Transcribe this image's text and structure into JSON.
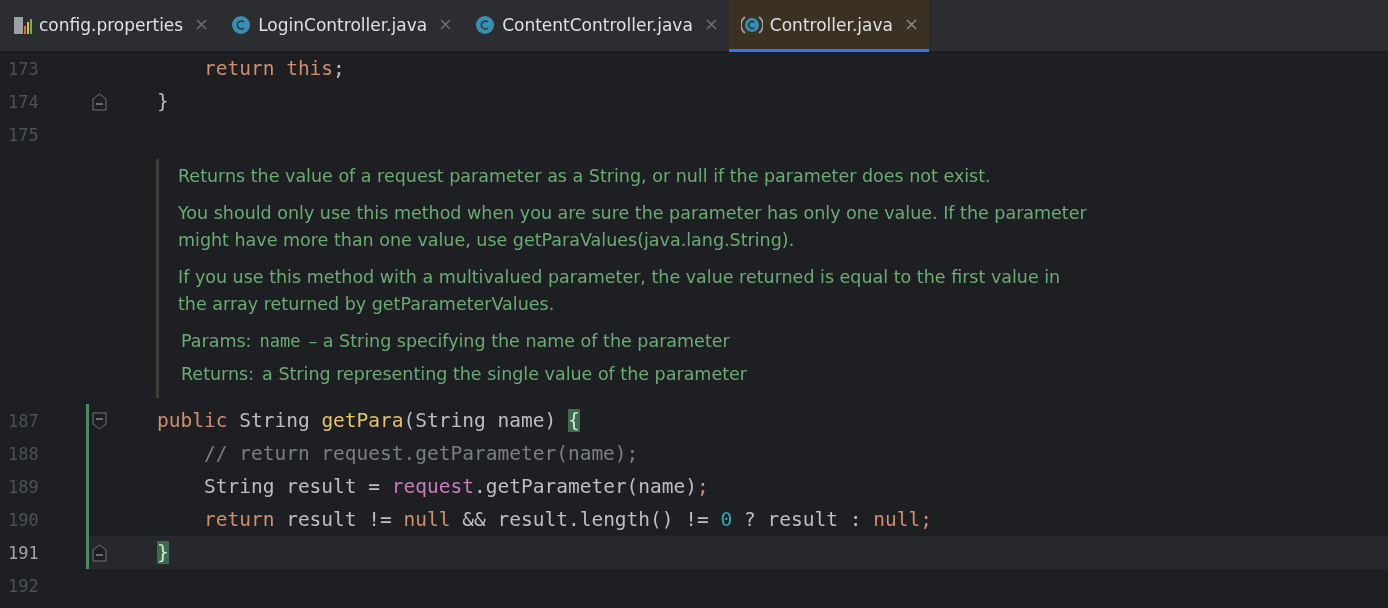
{
  "tabs": [
    {
      "label": "config.properties",
      "kind": "properties",
      "selected": false
    },
    {
      "label": "LoginController.java",
      "kind": "class",
      "selected": false
    },
    {
      "label": "ContentController.java",
      "kind": "class",
      "selected": false
    },
    {
      "label": "Controller.java",
      "kind": "abstract-class",
      "selected": true
    }
  ],
  "editor": {
    "lines_before": [
      {
        "number": "173",
        "current": false,
        "changed": false,
        "tokens": [
          {
            "kind": "keyword",
            "text": "    return this"
          },
          {
            "kind": "plain",
            "text": ";"
          }
        ]
      },
      {
        "number": "174",
        "current": false,
        "changed": false,
        "kind": "fold-end",
        "tokens": [
          {
            "kind": "plain",
            "text": "}"
          }
        ]
      },
      {
        "number": "175",
        "current": false,
        "changed": false
      }
    ],
    "doc": {
      "paragraphs": [
        "Returns the value of a request parameter as a String, or null if the parameter does not exist.",
        "You should only use this method when you are sure the parameter has only one value. If the parameter might have more than one value, use getParaValues(java.lang.String).",
        "If you use this method with a multivalued parameter, the value returned is equal to the first value in the array returned by getParameterValues."
      ],
      "tags": [
        {
          "label": "Params:",
          "code": "name",
          "text": "– a String specifying the name of the parameter"
        },
        {
          "label": "Returns:",
          "text": "a String representing the single value of the parameter"
        }
      ]
    },
    "lines_after": [
      {
        "number": "187",
        "current": false,
        "changed": true,
        "kind": "fold-start",
        "tokens": [
          {
            "kind": "keyword",
            "text": "public "
          },
          {
            "kind": "plain",
            "text": "String "
          },
          {
            "kind": "method",
            "text": "getPara"
          },
          {
            "kind": "plain",
            "text": "(String name) "
          },
          {
            "kind": "brace-match",
            "text": "{"
          }
        ]
      },
      {
        "number": "188",
        "current": false,
        "changed": true,
        "tokens": [
          {
            "kind": "comment",
            "text": "    // return request.getParameter(name);"
          }
        ]
      },
      {
        "number": "189",
        "current": false,
        "changed": true,
        "tokens": [
          {
            "kind": "plain",
            "text": "    String result = "
          },
          {
            "kind": "field",
            "text": "request"
          },
          {
            "kind": "plain",
            "text": ".getParameter(name)"
          },
          {
            "kind": "keyword",
            "text": ";"
          }
        ]
      },
      {
        "number": "190",
        "current": false,
        "changed": true,
        "tokens": [
          {
            "kind": "keyword",
            "text": "    return "
          },
          {
            "kind": "plain",
            "text": "result != "
          },
          {
            "kind": "keyword",
            "text": "null "
          },
          {
            "kind": "plain",
            "text": "&& result.length() != "
          },
          {
            "kind": "number",
            "text": "0"
          },
          {
            "kind": "plain",
            "text": " ? result : "
          },
          {
            "kind": "keyword",
            "text": "null;"
          }
        ]
      },
      {
        "number": "191",
        "current": true,
        "changed": true,
        "kind": "fold-end",
        "tokens": [
          {
            "kind": "brace-match",
            "text": "}"
          }
        ]
      },
      {
        "number": "192",
        "current": false,
        "changed": false
      }
    ]
  }
}
